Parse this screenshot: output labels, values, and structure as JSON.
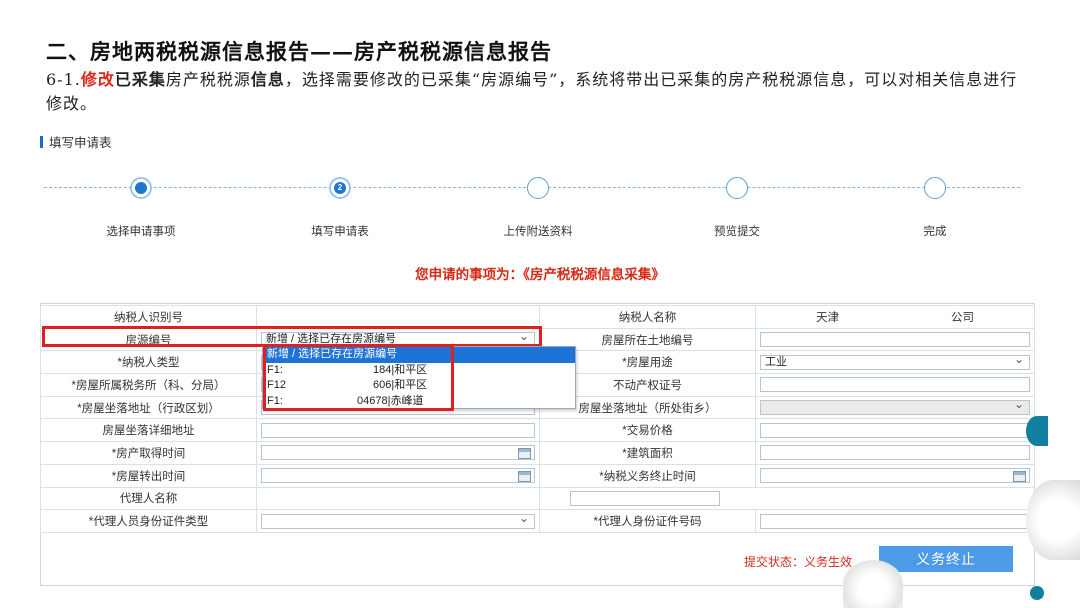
{
  "slide": {
    "title": "二、房地两税税源信息报告——房产税税源信息报告",
    "desc_prefix": "6-1.",
    "desc_modify": "修改",
    "desc_collected": "已采集",
    "desc_mid": "房产税税源",
    "desc_info": "信息",
    "desc_rest": "，选择需要修改的已采集“房源编号”，系统将带出已采集的房产税税源信息，可以对相关信息进行修改。"
  },
  "section": {
    "label": "填写申请表"
  },
  "steps": [
    {
      "label": "选择申请事项",
      "status": "done"
    },
    {
      "label": "填写申请表",
      "status": "current",
      "number": "2"
    },
    {
      "label": "上传附送资料",
      "status": "todo"
    },
    {
      "label": "预览提交",
      "status": "todo"
    },
    {
      "label": "完成",
      "status": "todo"
    }
  ],
  "notice": "您申请的事项为：《房产税税源信息采集》",
  "form": {
    "taxpayer_id_label": "纳税人识别号",
    "taxpayer_id_value": "",
    "taxpayer_name_label": "纳税人名称",
    "taxpayer_name_part1": "天津",
    "taxpayer_name_part2": "公司",
    "house_no_label": "房源编号",
    "house_no_value": "新增 / 选择已存在房源编号",
    "land_no_label": "房屋所在土地编号",
    "land_no_value": "",
    "taxpayer_type_label": "*纳税人类型",
    "house_use_label": "*房屋用途",
    "house_use_value": "工业",
    "tax_office_label": "*房屋所属税务所（科、分局）",
    "property_cert_label": "不动产权证号",
    "district_label": "*房屋坐落地址（行政区划）",
    "street_label": "*房屋坐落地址（所处街乡）",
    "street_label_visible": "房屋坐落地址（所处街乡）",
    "detail_addr_label": "房屋坐落详细地址",
    "price_label": "*交易价格",
    "acquire_time_label": "*房产取得时间",
    "area_label": "*建筑面积",
    "transfer_time_label": "*房屋转出时间",
    "end_time_label": "*纳税义务终止时间",
    "agent_name_label": "代理人名称",
    "agent_id_type_label": "*代理人员身份证件类型",
    "agent_id_no_label": "*代理人身份证件号码"
  },
  "dropdown": {
    "options": [
      {
        "code": "新增 / 选择已存在房源编号",
        "tail": ""
      },
      {
        "code": "F1:",
        "tail": "184|和平区"
      },
      {
        "code": "F12",
        "tail": "606|和平区"
      },
      {
        "code": "F1:",
        "tail": "04678|赤峰道"
      }
    ]
  },
  "footer": {
    "status_label": "提交状态：",
    "status_value": "义务生效",
    "terminate_button": "义务终止"
  },
  "colors": {
    "accent": "#1a77d2",
    "highlight": "#e02020",
    "notice": "#d42a17",
    "button": "#4c9ae8"
  }
}
